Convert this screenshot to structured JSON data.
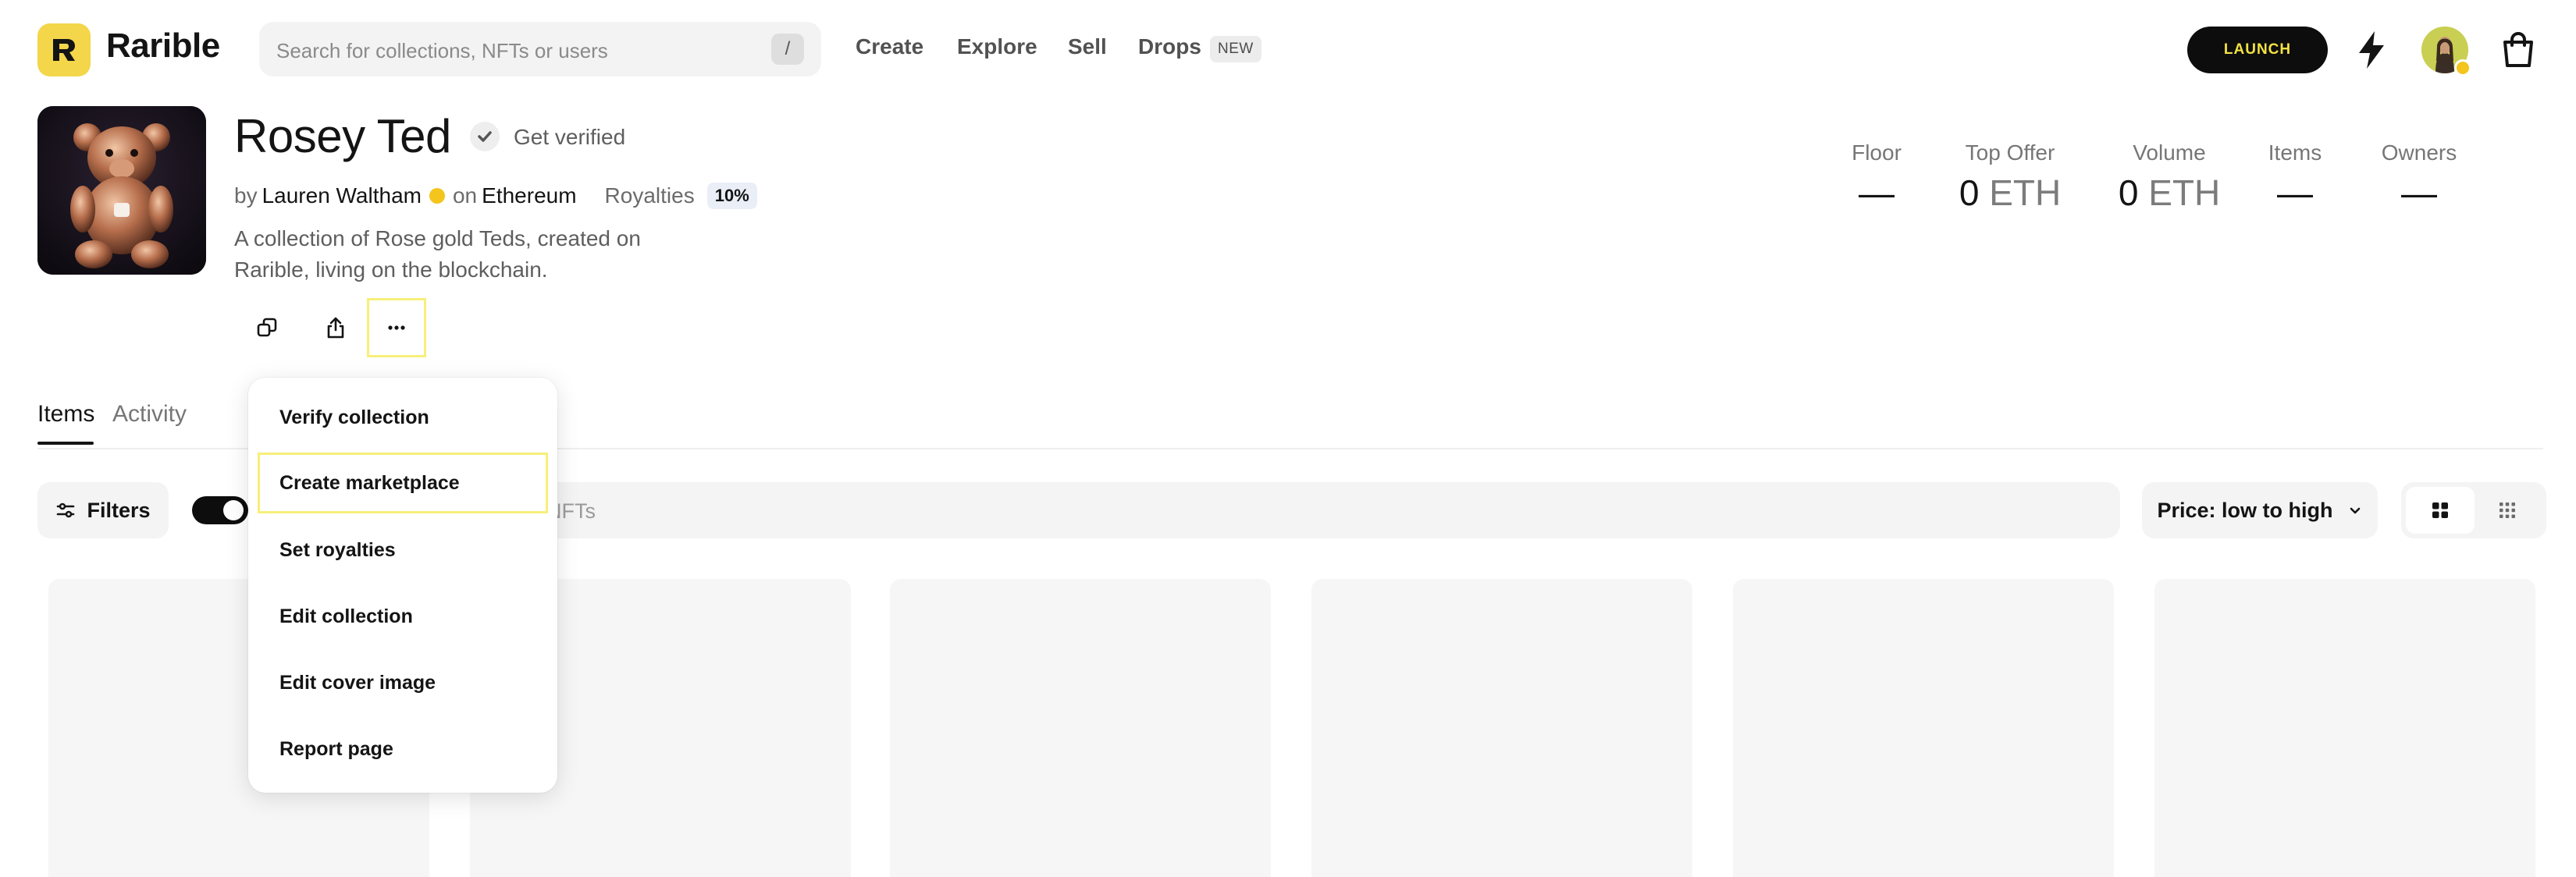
{
  "header": {
    "brand": "Rarible",
    "search": {
      "placeholder": "Search for collections, NFTs or users",
      "shortcut": "/"
    },
    "nav": [
      "Create",
      "Explore",
      "Sell",
      "Drops"
    ],
    "drops_badge": "NEW",
    "launch_label": "LAUNCH"
  },
  "collection": {
    "name": "Rosey Ted",
    "verify_label": "Get verified",
    "by": "by",
    "creator": "Lauren Waltham",
    "on": "on",
    "chain": "Ethereum",
    "royalties_label": "Royalties",
    "royalties_value": "10%",
    "description": "A collection of Rose gold Teds, created on Rarible, living on the blockchain."
  },
  "stats": [
    {
      "label": "Floor",
      "value": "—",
      "unit": ""
    },
    {
      "label": "Top Offer",
      "value": "0",
      "unit": "ETH"
    },
    {
      "label": "Volume",
      "value": "0",
      "unit": "ETH"
    },
    {
      "label": "Items",
      "value": "—",
      "unit": ""
    },
    {
      "label": "Owners",
      "value": "—",
      "unit": ""
    }
  ],
  "tabs": [
    "Items",
    "Activity"
  ],
  "toolbar": {
    "filters_label": "Filters",
    "search_placeholder_visible": "NFTs",
    "sort_label": "Price: low to high"
  },
  "menu": {
    "items": [
      "Verify collection",
      "Create marketplace",
      "Set royalties",
      "Edit collection",
      "Edit cover image",
      "Report page"
    ]
  },
  "colors": {
    "brand": "#f3d64a",
    "launch_text": "#f3e243",
    "verified": "#f3c51d",
    "highlight": "#f7ef7a"
  }
}
